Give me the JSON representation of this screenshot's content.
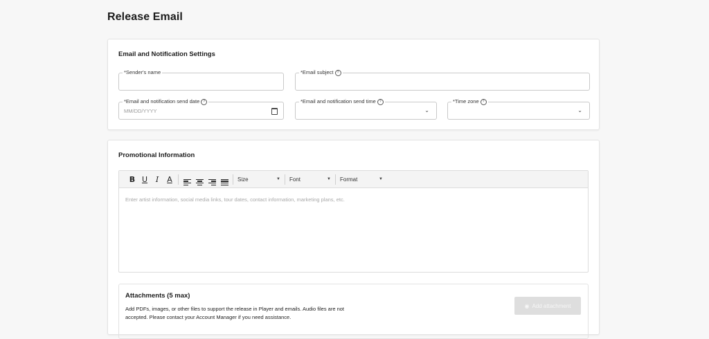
{
  "page": {
    "title": "Release Email"
  },
  "notifications": {
    "title": "Email and Notification Settings",
    "sender_label": "*Sender's name",
    "subject_label": "*Email subject",
    "send_date_label": "*Email and notification send date",
    "send_date_placeholder": "MM/DD/YYYY",
    "send_time_label": "*Email and notification send time",
    "timezone_label": "*Time zone"
  },
  "promo": {
    "title": "Promotional Information",
    "toolbar": {
      "bold": "B",
      "underline": "U",
      "italic": "I",
      "color": "A",
      "size": "Size",
      "font": "Font",
      "format": "Format"
    },
    "editor_placeholder": "Enter artist information, social media links, tour dates, contact information, marketing plans, etc."
  },
  "attachments": {
    "title": "Attachments (5 max)",
    "description": "Add PDFs, images, or other files to support the release in Player and emails. Audio files are not accepted. Please contact your Account Manager if you need assistance.",
    "button": "Add attachment",
    "button_icon": "eye-icon"
  },
  "colors": {
    "background": "#f7f7f7",
    "card": "#ffffff",
    "border": "#c9c9c9",
    "disabled_button": "#dedede"
  }
}
